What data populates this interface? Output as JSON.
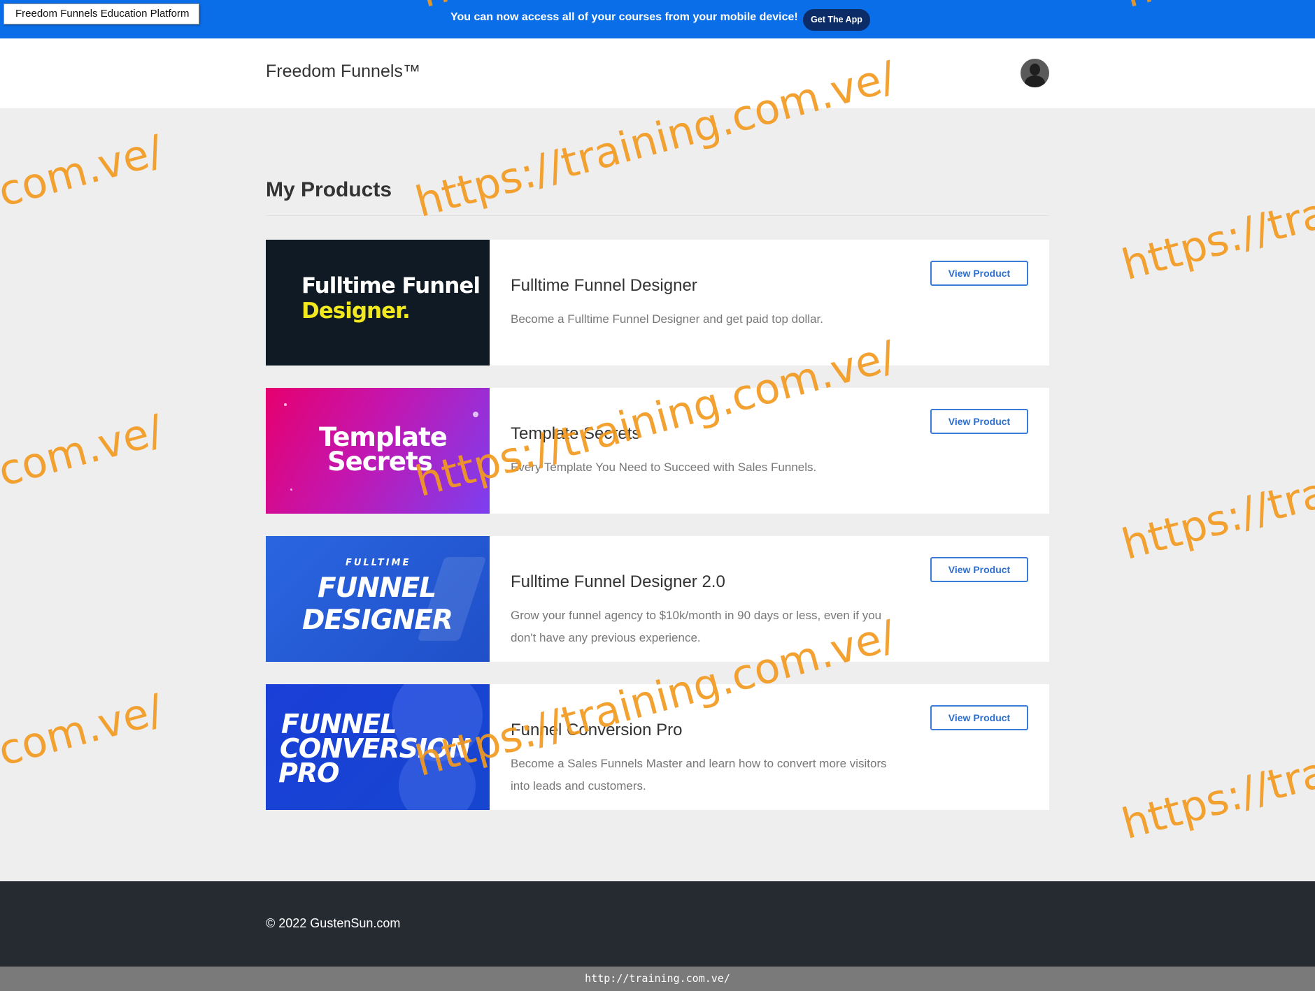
{
  "window": {
    "title": "Freedom Funnels Education Platform"
  },
  "banner": {
    "message": "You can now access all of your courses from your mobile device!",
    "app_button": "Get The App"
  },
  "header": {
    "brand": "Freedom Funnels™",
    "avatar_icon": "user-avatar-icon"
  },
  "main": {
    "title": "My Products",
    "products": [
      {
        "thumb_lines": [
          "Fulltime Funnel",
          "Designer."
        ],
        "title": "Fulltime Funnel Designer",
        "description": "Become a Fulltime Funnel Designer and get paid top dollar.",
        "button": "View Product"
      },
      {
        "thumb_lines": [
          "Template",
          "Secrets"
        ],
        "title": "Template Secrets",
        "description": "Every Template You Need to Succeed with Sales Funnels.",
        "button": "View Product"
      },
      {
        "thumb_lines": [
          "FULLTIME",
          "FUNNEL",
          "DESIGNER"
        ],
        "title": "Fulltime Funnel Designer 2.0",
        "description": "Grow your funnel agency to $10k/month in 90 days or less, even if you don't have any previous experience.",
        "button": "View Product"
      },
      {
        "thumb_lines": [
          "FUNNEL",
          "CONVERSION",
          "PRO"
        ],
        "title": "Funnel Conversion Pro",
        "description": "Become a Sales Funnels Master and learn how to convert more visitors into leads and customers.",
        "button": "View Product"
      }
    ]
  },
  "footer": {
    "copyright": "© 2022 GustenSun.com"
  },
  "status_bar": {
    "url": "http://training.com.ve/"
  },
  "watermark": {
    "text": "https://training.com.ve/",
    "partial_left": ".com.ve/",
    "partial_right": "https://tra",
    "partial_top": "http"
  },
  "colors": {
    "banner": "#0a6ee8",
    "accent": "#3a7bd5",
    "footer": "#262b32",
    "watermark": "#f39a1f"
  }
}
